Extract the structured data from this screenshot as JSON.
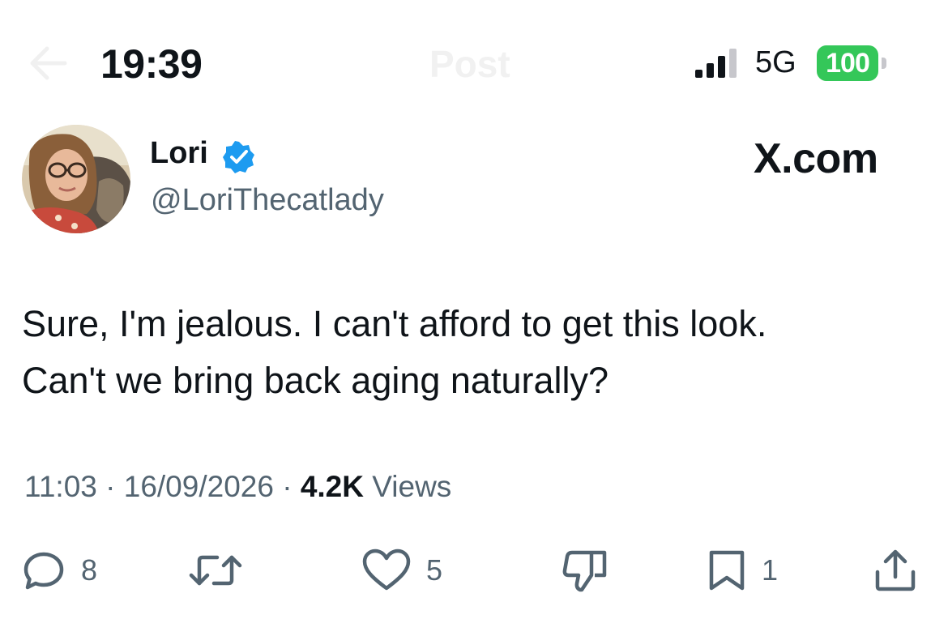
{
  "status_bar": {
    "time": "19:39",
    "screen_title": "Post",
    "network": "5G",
    "battery": "100"
  },
  "post": {
    "author_name": "Lori",
    "author_handle": "@LoriThecatlady",
    "verified": true,
    "watermark": "X.com",
    "text_lines": [
      "Sure, I'm jealous. I can't afford to get this look.",
      "Can't we bring back aging naturally?"
    ],
    "time": "11:03",
    "separator": "·",
    "date": "16/09/2026",
    "views_count": "4.2K",
    "views_label": "Views"
  },
  "actions": {
    "replies": "8",
    "likes": "5",
    "bookmarks": "1"
  },
  "colors": {
    "text": "#0f1419",
    "secondary": "#536471",
    "verified": "#1d9bf0",
    "battery": "#34c759"
  }
}
